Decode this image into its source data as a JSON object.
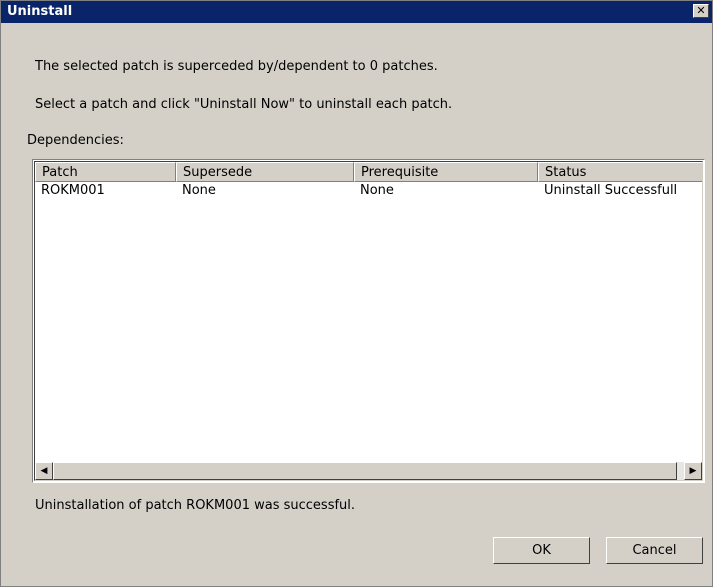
{
  "window": {
    "title": "Uninstall",
    "close_glyph": "✕"
  },
  "messages": {
    "line1": "The selected patch is superceded by/dependent to 0 patches.",
    "line2": "Select a patch and click \"Uninstall Now\" to uninstall each patch.",
    "dependencies_label": "Dependencies:",
    "status": "Uninstallation of patch ROKM001 was successful."
  },
  "table": {
    "columns": [
      "Patch",
      "Supersede",
      "Prerequisite",
      "Status"
    ],
    "rows": [
      [
        "ROKM001",
        "None",
        "None",
        "Uninstall Successfull"
      ]
    ]
  },
  "scrollbar": {
    "left_glyph": "◀",
    "right_glyph": "▶"
  },
  "buttons": {
    "ok_label": "OK",
    "cancel_label": "Cancel"
  },
  "colors": {
    "titlebar": "#0a246a",
    "face": "#d4d0c8"
  }
}
